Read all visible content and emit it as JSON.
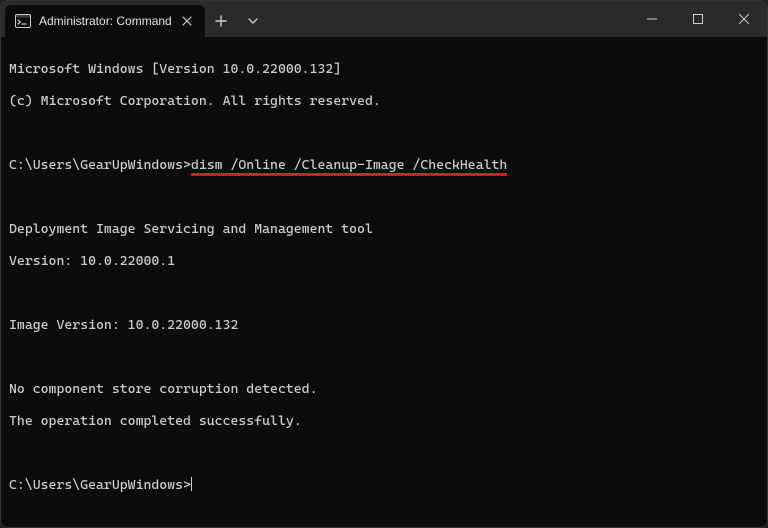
{
  "titlebar": {
    "tab_title": "Administrator: Command Prompt",
    "tab_icon": "cmd-icon",
    "close_glyph": "✕",
    "newtab_glyph": "+",
    "dropdown_glyph": "⌄"
  },
  "terminal": {
    "line1": "Microsoft Windows [Version 10.0.22000.132]",
    "line2": "(c) Microsoft Corporation. All rights reserved.",
    "prompt1_prefix": "C:\\Users\\GearUpWindows>",
    "prompt1_command": "dism /Online /Cleanup-Image /CheckHealth",
    "line_tool": "Deployment Image Servicing and Management tool",
    "line_ver": "Version: 10.0.22000.1",
    "line_imgver": "Image Version: 10.0.22000.132",
    "line_res1": "No component store corruption detected.",
    "line_res2": "The operation completed successfully.",
    "prompt2": "C:\\Users\\GearUpWindows>"
  },
  "colors": {
    "bg": "#0c0c0c",
    "titlebar": "#2b2b2b",
    "text": "#cccccc",
    "underline": "#d82626"
  }
}
